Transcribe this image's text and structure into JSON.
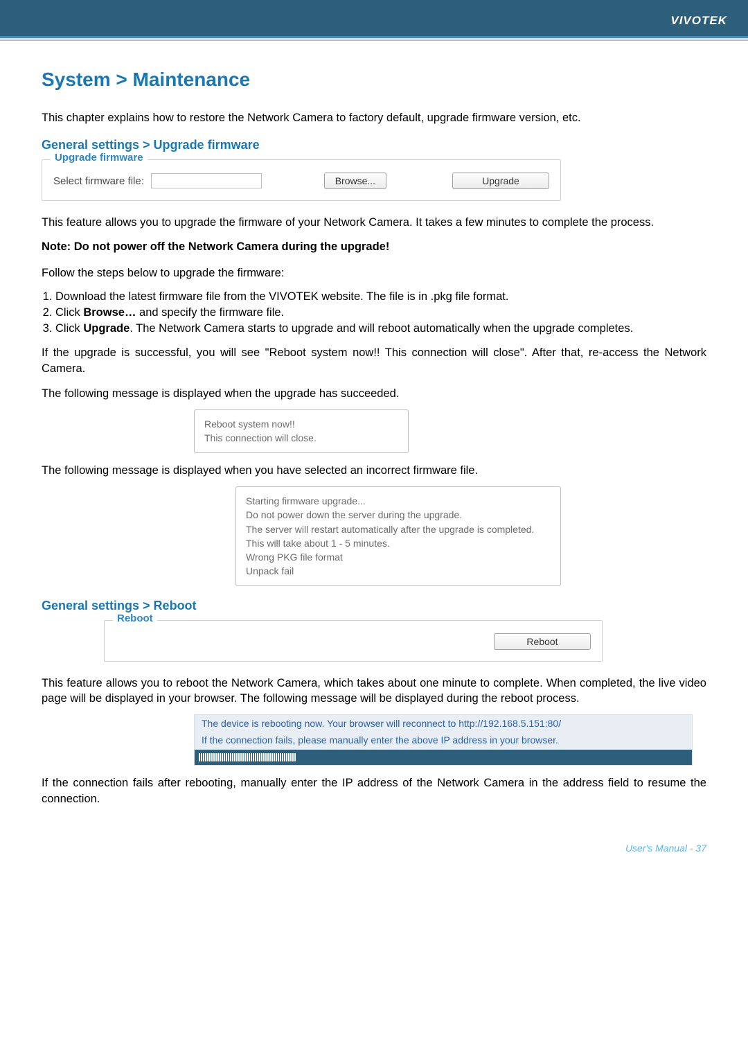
{
  "brand": "VIVOTEK",
  "title": "System > Maintenance",
  "intro": "This chapter explains how to restore the Network Camera to factory default, upgrade firmware version, etc.",
  "upgrade": {
    "heading": "General settings > Upgrade firmware",
    "legend": "Upgrade firmware",
    "file_label": "Select firmware file:",
    "browse_btn": "Browse...",
    "upgrade_btn": "Upgrade",
    "p1": "This feature allows you to upgrade the firmware of your Network Camera. It takes a few minutes to complete the process.",
    "note": "Note: Do not power off the Network Camera during the upgrade!",
    "steps_lead": "Follow the steps below to upgrade the firmware:",
    "step1": "Download the latest firmware file from the VIVOTEK website. The file is in .pkg file format.",
    "step2a": "Click ",
    "step2b": "Browse…",
    "step2c": " and specify the firmware file.",
    "step3a": "Click ",
    "step3b": "Upgrade",
    "step3c": ". The Network Camera starts to upgrade and will reboot automatically when the upgrade completes.",
    "success_para": "If the upgrade is successful, you will see \"Reboot system now!! This connection will close\". After that, re-access the Network Camera.",
    "succeeded_lead": "The following message is displayed when the upgrade has succeeded.",
    "succ_msg_l1": "Reboot system now!!",
    "succ_msg_l2": "This connection will close.",
    "wrong_lead": "The following message is displayed when you have selected an incorrect firmware file.",
    "wrong_msg_l1": "Starting firmware upgrade...",
    "wrong_msg_l2": "Do not power down the server during the upgrade.",
    "wrong_msg_l3": "The server will restart automatically after the upgrade is completed.",
    "wrong_msg_l4": "This will take about 1 - 5 minutes.",
    "wrong_msg_l5": "Wrong PKG file format",
    "wrong_msg_l6": "Unpack fail"
  },
  "reboot": {
    "heading": "General settings > Reboot",
    "legend": "Reboot",
    "btn": "Reboot",
    "p1": "This feature allows you to reboot the Network Camera, which takes about one minute to complete. When completed, the live video page will be displayed in your browser. The following message will be displayed during the reboot process.",
    "banner_l1": "The device is rebooting now. Your browser will reconnect to http://192.168.5.151:80/",
    "banner_l2": "If the connection fails, please manually enter the above IP address in your browser.",
    "p2": "If the connection fails after rebooting, manually enter the IP address of the Network Camera in the address field to resume the connection."
  },
  "footer": "User's Manual - 37"
}
